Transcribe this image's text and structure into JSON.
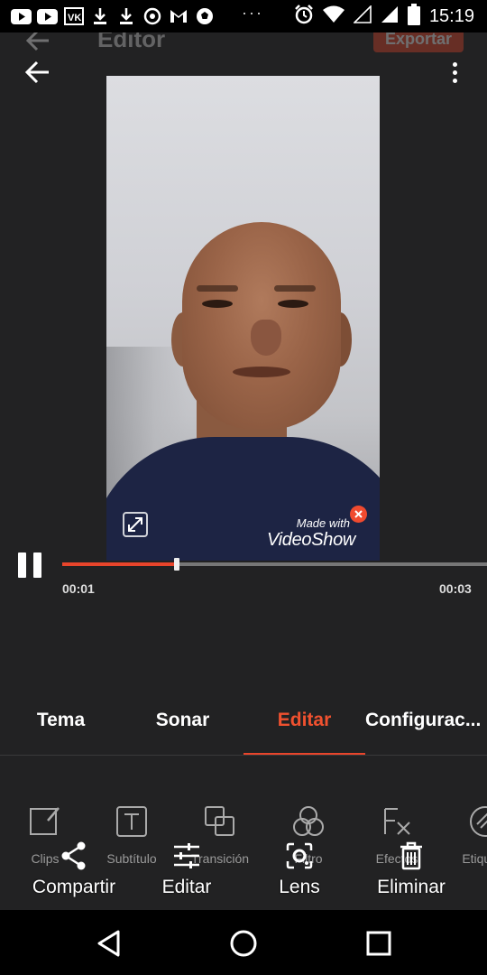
{
  "status_bar": {
    "time": "15:19",
    "overflow": "···",
    "left_icons": [
      "youtube-icon",
      "youtube-icon",
      "vk-icon",
      "download-icon",
      "download-icon",
      "whatsapp-icon",
      "gmail-icon",
      "soccer-ball-icon"
    ],
    "right_icons": [
      "alarm-icon",
      "wifi-icon",
      "signal-empty-icon",
      "signal-icon",
      "battery-icon"
    ]
  },
  "header_ghost": {
    "title": "Editor",
    "export_label": "Exportar"
  },
  "video": {
    "watermark_small": "Made with",
    "watermark_big": "VideoShow"
  },
  "player": {
    "current_time": "00:01",
    "total_time": "00:03",
    "progress": 0.27
  },
  "tabs": [
    {
      "label": "Tema"
    },
    {
      "label": "Sonar"
    },
    {
      "label": "Editar"
    },
    {
      "label": "Configurac..."
    }
  ],
  "active_tab": "Editar",
  "tools": [
    {
      "label": "Clips",
      "icon": "clip-edit-icon"
    },
    {
      "label": "Subtítulo",
      "icon": "text-icon"
    },
    {
      "label": "Transición",
      "icon": "transition-icon"
    },
    {
      "label": "Filtro",
      "icon": "filter-icon"
    },
    {
      "label": "Efectos",
      "icon": "fx-icon"
    },
    {
      "label": "Etiqueta",
      "icon": "sticker-icon"
    }
  ],
  "actions": [
    {
      "label": "Compartir",
      "icon": "share-icon"
    },
    {
      "label": "Editar",
      "icon": "sliders-icon"
    },
    {
      "label": "Lens",
      "icon": "lens-icon"
    },
    {
      "label": "Eliminar",
      "icon": "trash-icon"
    }
  ],
  "colors": {
    "accent": "#e8452b",
    "background": "#222223"
  }
}
